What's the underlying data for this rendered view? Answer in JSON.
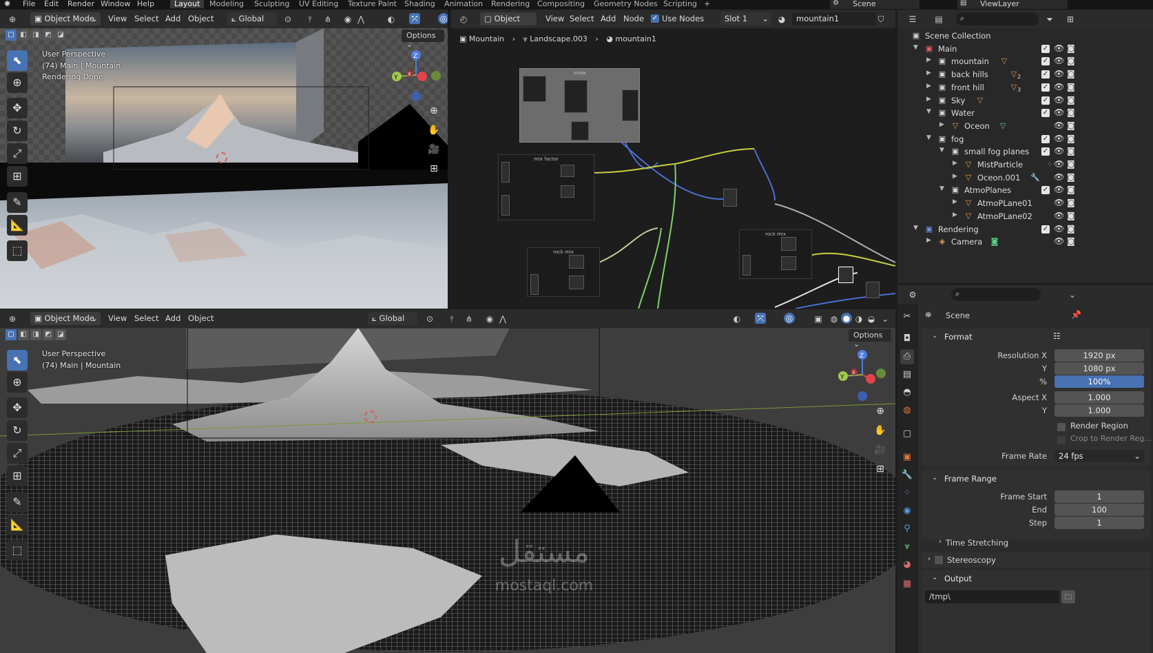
{
  "topbar": {
    "menus": [
      "File",
      "Edit",
      "Render",
      "Window",
      "Help"
    ],
    "workspaces": [
      "Layout",
      "Modeling",
      "Sculpting",
      "UV Editing",
      "Texture Paint",
      "Shading",
      "Animation",
      "Rendering",
      "Compositing",
      "Geometry Nodes",
      "Scripting"
    ],
    "active_workspace": "Layout",
    "add_tab": "+",
    "scene": "Scene",
    "view_layer": "ViewLayer"
  },
  "viewport_top": {
    "mode": "Object Mode",
    "menus": [
      "View",
      "Select",
      "Add",
      "Object"
    ],
    "transform": "Global",
    "options": "Options",
    "overlay": {
      "line1": "User Perspective",
      "line2": "(74) Main | Mountain",
      "line3": "Rendering Done"
    }
  },
  "node_editor": {
    "type": "Object",
    "menus": [
      "View",
      "Select",
      "Add",
      "Node"
    ],
    "use_nodes_label": "Use Nodes",
    "use_nodes": true,
    "slot": "Slot 1",
    "material": "mountain1",
    "breadcrumb": [
      "Mountain",
      "Landscape.003",
      "mountain1"
    ],
    "frames": [
      {
        "label": "snow"
      },
      {
        "label": "mix factor"
      },
      {
        "label": "rock mix"
      },
      {
        "label": "rock mix"
      }
    ]
  },
  "viewport_bottom": {
    "mode": "Object Mode",
    "menus": [
      "View",
      "Select",
      "Add",
      "Object"
    ],
    "transform": "Global",
    "options": "Options",
    "overlay": {
      "line1": "User Perspective",
      "line2": "(74) Main | Mountain"
    }
  },
  "gizmo": {
    "z": "Z",
    "y": "Y",
    "x": "X"
  },
  "outliner": {
    "rows": [
      {
        "label": "Scene Collection",
        "depth": 0,
        "icon": "collection-icon"
      },
      {
        "label": "Main",
        "depth": 1,
        "icon": "collection-red-icon",
        "arrow": "open"
      },
      {
        "label": "mountain",
        "depth": 2,
        "icon": "collection-icon",
        "arrow": "closed",
        "extra": "mesh-tag-icon",
        "extra_count": ""
      },
      {
        "label": "back hills",
        "depth": 2,
        "icon": "collection-icon",
        "arrow": "closed",
        "extra": "mesh-tag-icon",
        "extra_count": "2"
      },
      {
        "label": "front hill",
        "depth": 2,
        "icon": "collection-icon",
        "arrow": "closed",
        "extra": "mesh-tag-icon",
        "extra_count": "3"
      },
      {
        "label": "Sky",
        "depth": 2,
        "icon": "collection-icon",
        "arrow": "closed",
        "extra": "mesh-tag-icon",
        "extra_count": ""
      },
      {
        "label": "Water",
        "depth": 2,
        "icon": "collection-icon",
        "arrow": "open"
      },
      {
        "label": "Oceon",
        "depth": 3,
        "icon": "mesh-icon",
        "arrow": "closed",
        "extra": "geometry-icon",
        "extra_count": ""
      },
      {
        "label": "fog",
        "depth": 2,
        "icon": "collection-icon",
        "arrow": "open"
      },
      {
        "label": "small fog planes",
        "depth": 3,
        "icon": "collection-icon",
        "arrow": "open"
      },
      {
        "label": "MistParticle",
        "depth": 4,
        "icon": "mesh-icon",
        "arrow": "closed",
        "extra": "particle-icon",
        "extra_count": ""
      },
      {
        "label": "Oceon.001",
        "depth": 4,
        "icon": "mesh-icon",
        "arrow": "closed",
        "extra": "wrench-icon",
        "extra_count": ""
      },
      {
        "label": "AtmoPlanes",
        "depth": 3,
        "icon": "collection-icon",
        "arrow": "open"
      },
      {
        "label": "AtmoPLane01",
        "depth": 4,
        "icon": "mesh-icon",
        "arrow": "closed"
      },
      {
        "label": "AtmoPLane02",
        "depth": 4,
        "icon": "mesh-icon",
        "arrow": "closed"
      },
      {
        "label": "Rendering",
        "depth": 1,
        "icon": "collection-blue-icon",
        "arrow": "open"
      },
      {
        "label": "Camera",
        "depth": 2,
        "icon": "camera-object-icon",
        "arrow": "closed",
        "extra": "camera-data-icon",
        "extra_count": ""
      }
    ]
  },
  "properties": {
    "context": "Scene",
    "format": {
      "title": "Format",
      "resolution_x_label": "Resolution X",
      "resolution_x": "1920 px",
      "y_label": "Y",
      "resolution_y": "1080 px",
      "pct_label": "%",
      "pct": "100%",
      "aspect_x_label": "Aspect X",
      "aspect_x": "1.000",
      "aspect_y_label": "Y",
      "aspect_y": "1.000",
      "render_region": "Render Region",
      "crop": "Crop to Render Reg...",
      "frame_rate_label": "Frame Rate",
      "frame_rate": "24 fps"
    },
    "frame_range": {
      "title": "Frame Range",
      "start_label": "Frame Start",
      "start": "1",
      "end_label": "End",
      "end": "100",
      "step_label": "Step",
      "step": "1"
    },
    "time_stretching": "Time Stretching",
    "stereoscopy": "Stereoscopy",
    "output": {
      "title": "Output",
      "path": "/tmp\\"
    }
  },
  "watermark": {
    "arabic": "مستقل",
    "latin": "mostaql.com"
  },
  "colors": {
    "accent": "#4772b3",
    "header": "#2b2b2b",
    "panel": "#303030"
  }
}
